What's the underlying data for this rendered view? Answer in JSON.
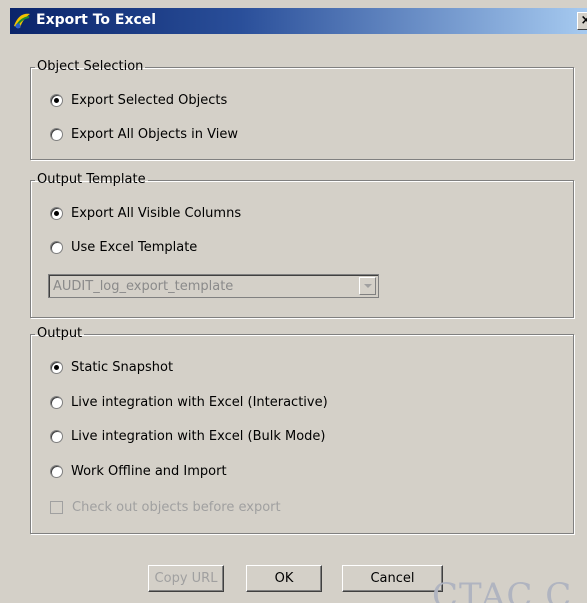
{
  "window": {
    "title": "Export To Excel",
    "close_glyph": "×"
  },
  "object_selection": {
    "legend": "Object Selection",
    "options": [
      {
        "label": "Export Selected Objects",
        "checked": true
      },
      {
        "label": "Export All Objects in View",
        "checked": false
      }
    ]
  },
  "output_template": {
    "legend": "Output Template",
    "options": [
      {
        "label": "Export All Visible Columns",
        "checked": true
      },
      {
        "label": "Use Excel Template",
        "checked": false
      }
    ],
    "template_select": {
      "value": "AUDIT_log_export_template",
      "enabled": false
    }
  },
  "output": {
    "legend": "Output",
    "options": [
      {
        "label": "Static Snapshot",
        "checked": true
      },
      {
        "label": "Live integration with Excel (Interactive)",
        "checked": false
      },
      {
        "label": "Live integration with Excel (Bulk Mode)",
        "checked": false
      },
      {
        "label": "Work Offline and Import",
        "checked": false
      }
    ],
    "checkout_checkbox": {
      "label": "Check out objects before export",
      "checked": false,
      "enabled": false
    }
  },
  "buttons": {
    "copy_url": "Copy URL",
    "ok": "OK",
    "cancel": "Cancel"
  },
  "watermark": "CTAC C",
  "colors": {
    "dialog_bg": "#d4d0c8",
    "titlebar_start": "#0a246a",
    "titlebar_end": "#a6caf0",
    "disabled_text": "#a0a0a0"
  }
}
